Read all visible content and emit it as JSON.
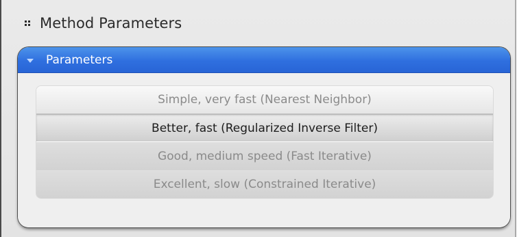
{
  "section": {
    "title": "Method Parameters",
    "grip_icon": "grip-icon"
  },
  "panel": {
    "title": "Parameters",
    "caret_icon": "caret-down-icon",
    "header_color": "#2f6fdf"
  },
  "options": [
    {
      "label": "Simple, very fast (Nearest Neighbor)"
    },
    {
      "label": "Better, fast (Regularized Inverse Filter)"
    },
    {
      "label": "Good, medium speed (Fast Iterative)"
    },
    {
      "label": "Excellent, slow (Constrained Iterative)"
    }
  ],
  "selected_option": "Better, fast (Regularized Inverse Filter)"
}
